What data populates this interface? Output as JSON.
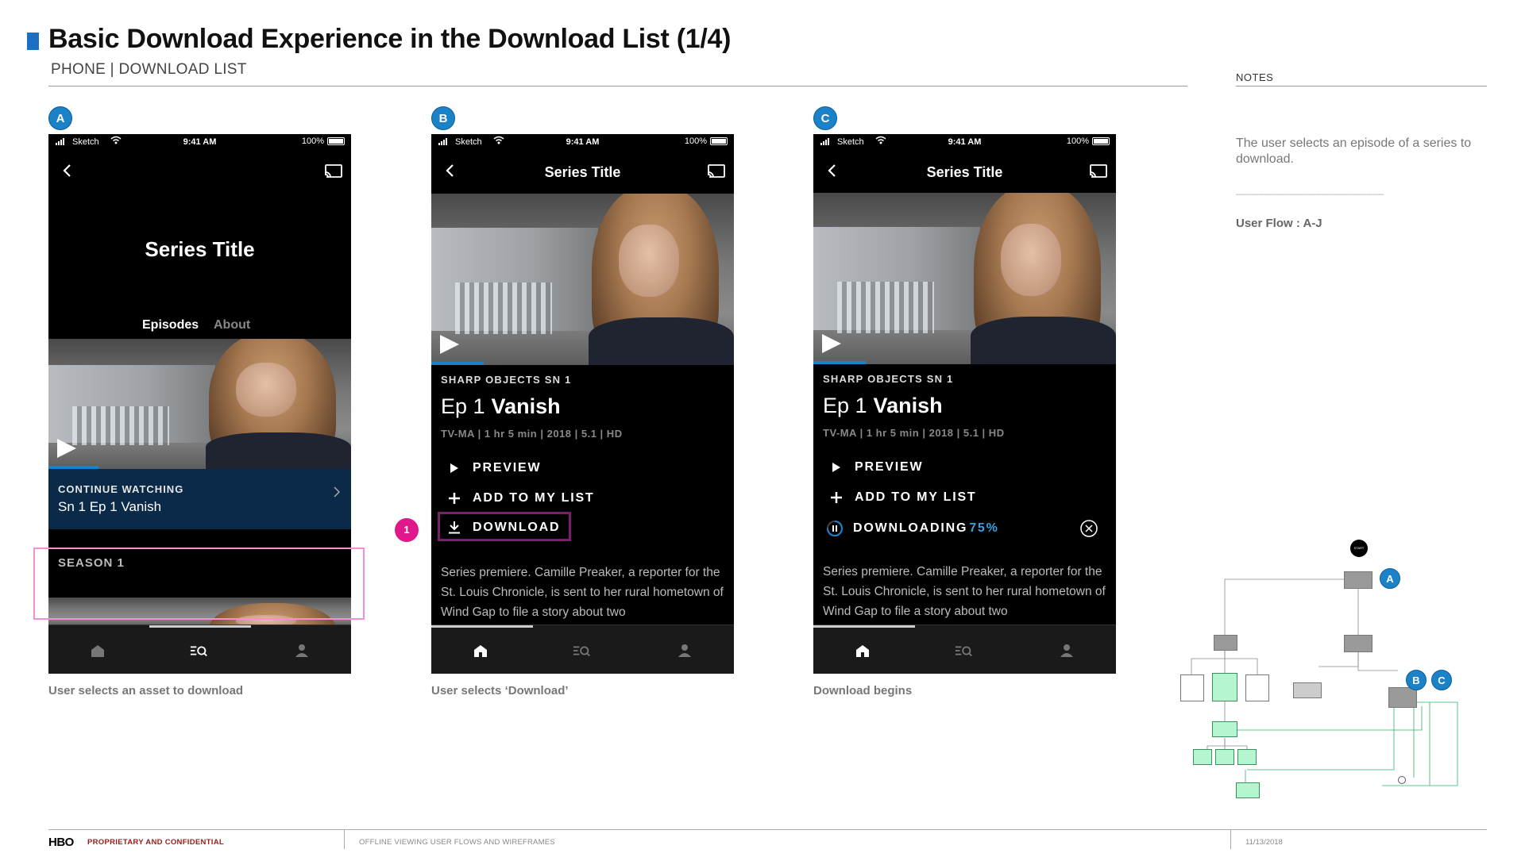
{
  "page": {
    "title": "Basic Download Experience in the Download List (1/4)",
    "subtitle": "PHONE | DOWNLOAD LIST"
  },
  "notes": {
    "label": "NOTES",
    "text": "The user selects an episode of a series to download.",
    "divider": "__________________________",
    "flow": "User Flow : A-J"
  },
  "status_bar": {
    "carrier": "Sketch",
    "time": "9:41 AM",
    "battery": "100%"
  },
  "screen_a": {
    "badge": "A",
    "series_title": "Series Title",
    "tabs": [
      "Episodes",
      "About"
    ],
    "continue_label": "CONTINUE WATCHING",
    "continue_episode": "Sn 1 Ep 1 Vanish",
    "season_label": "SEASON 1",
    "caption": "User selects an asset to download"
  },
  "screen_b": {
    "badge": "B",
    "nav_title": "Series Title",
    "show_line": "SHARP OBJECTS SN 1",
    "ep_number": "Ep 1",
    "ep_name": "Vanish",
    "info": "TV-MA | 1 hr 5 min | 2018 | 5.1 | HD",
    "actions": [
      "PREVIEW",
      "ADD TO MY LIST",
      "DOWNLOAD"
    ],
    "step_marker": "1",
    "synopsis": "Series premiere. Camille Preaker, a reporter for the St. Louis Chronicle, is sent to her rural hometown of Wind Gap to file a story about two",
    "caption": "User selects ‘Download’"
  },
  "screen_c": {
    "badge": "C",
    "nav_title": "Series Title",
    "show_line": "SHARP OBJECTS SN 1",
    "ep_number": "Ep 1",
    "ep_name": "Vanish",
    "info": "TV-MA | 1 hr 5 min | 2018 | 5.1 | HD",
    "actions": [
      "PREVIEW",
      "ADD TO MY LIST"
    ],
    "downloading_label": "DOWNLOADING",
    "downloading_percent": "75%",
    "download_progress": 0.75,
    "synopsis": "Series premiere. Camille Preaker, a reporter for the St. Louis Chronicle, is sent to her rural hometown of Wind Gap to file a story about two",
    "caption": "Download begins"
  },
  "flowmap": {
    "start": "START",
    "badges": [
      "A",
      "B",
      "C"
    ]
  },
  "footer": {
    "logo": "HBO",
    "confidential": "PROPRIETARY AND CONFIDENTIAL",
    "document": "OFFLINE VIEWING USER FLOWS AND WIREFRAMES",
    "date": "11/13/2018"
  },
  "colors": {
    "accent_blue": "#1c82c8",
    "highlight_pink": "#f58fd2",
    "download_border": "#7a1f6a",
    "step_magenta": "#e0188c",
    "confidential_red": "#9b1c1c"
  }
}
